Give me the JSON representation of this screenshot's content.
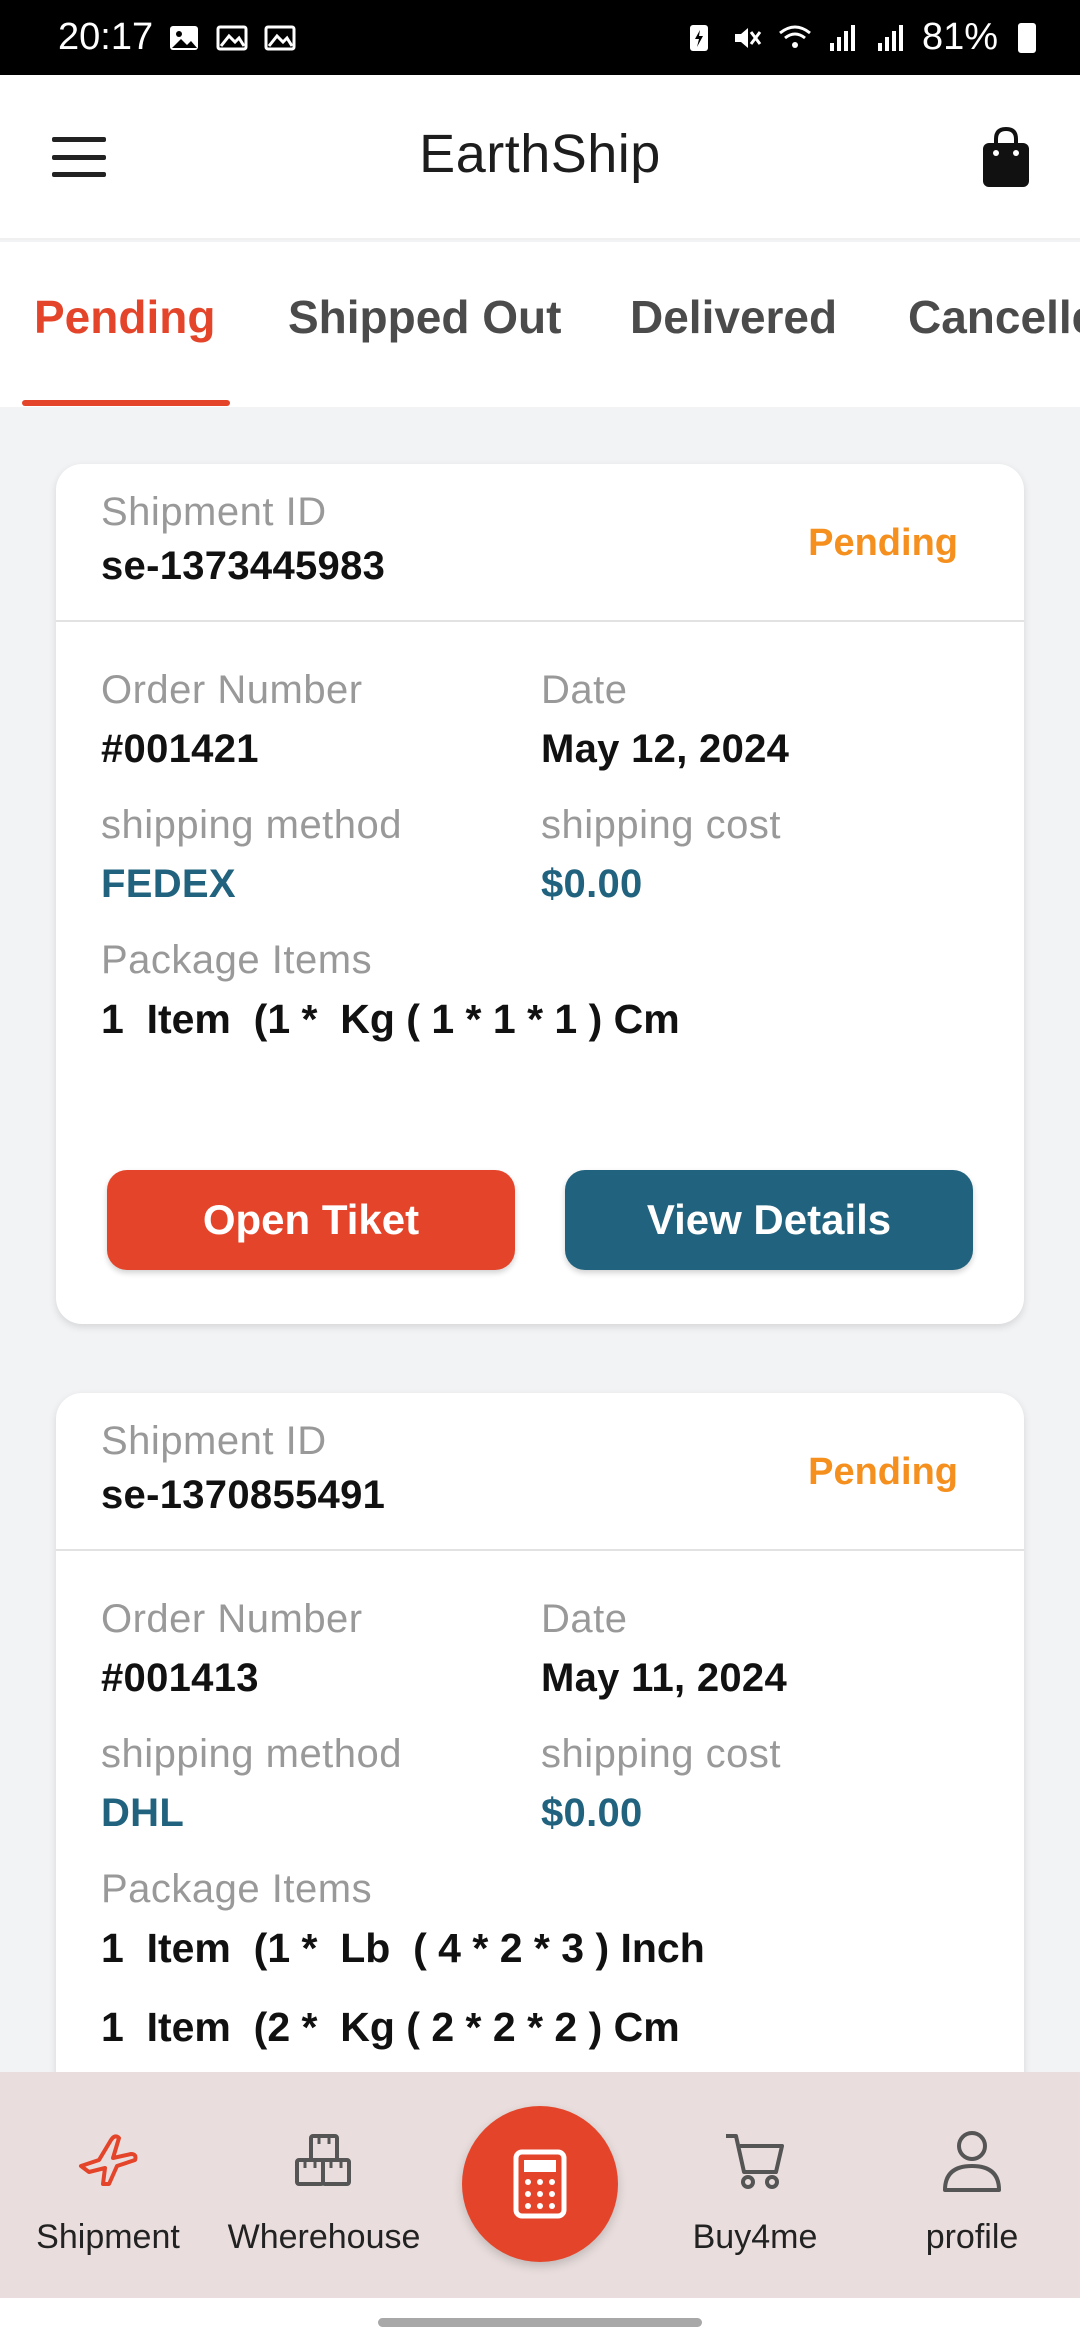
{
  "status_bar": {
    "time": "20:17",
    "battery": "81%"
  },
  "app_bar": {
    "title": "EarthShip"
  },
  "tabs": [
    {
      "label": "Pending"
    },
    {
      "label": "Shipped Out"
    },
    {
      "label": "Delivered"
    },
    {
      "label": "Cancelled"
    }
  ],
  "labels": {
    "shipment_id": "Shipment ID",
    "order_number": "Order Number",
    "date": "Date",
    "shipping_method": "shipping method",
    "shipping_cost": "shipping cost",
    "package_items": "Package Items"
  },
  "shipments": [
    {
      "id": "se-1373445983",
      "status": "Pending",
      "order_number": "#001421",
      "date": "May 12, 2024",
      "method": "FEDEX",
      "cost": "$0.00",
      "items": [
        "1  Item  (1 *  Kg ( 1 * 1 * 1 ) Cm"
      ],
      "open_ticket": "Open Tiket",
      "view_details": "View Details"
    },
    {
      "id": "se-1370855491",
      "status": "Pending",
      "order_number": "#001413",
      "date": "May 11, 2024",
      "method": "DHL",
      "cost": "$0.00",
      "items": [
        "1  Item  (1 *  Lb  ( 4 * 2 * 3 ) Inch",
        "1  Item  (2 *  Kg ( 2 * 2 * 2 ) Cm"
      ]
    }
  ],
  "bottom_nav": [
    {
      "label": "Shipment",
      "icon": "airplane-icon",
      "active": true
    },
    {
      "label": "Wherehouse",
      "icon": "boxes-icon"
    },
    {
      "label": "",
      "icon": "calculator-icon"
    },
    {
      "label": "Buy4me",
      "icon": "cart-icon"
    },
    {
      "label": "profile",
      "icon": "person-icon"
    }
  ],
  "colors": {
    "accent": "#e4452a",
    "teal": "#21637e",
    "pending": "#f5901f"
  }
}
